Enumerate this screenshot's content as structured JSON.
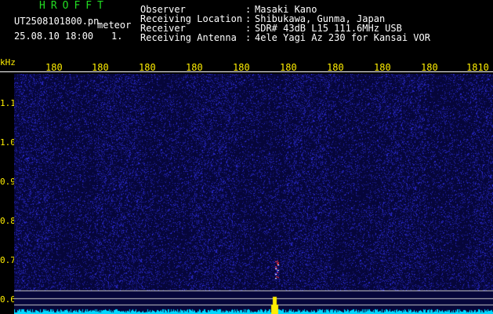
{
  "header": {
    "app_title": "HROFFT",
    "file_name": "UT2508101800.pn",
    "meteor_label": "meteor",
    "datetime": "25.08.10 18:00",
    "index": "1.",
    "info": [
      {
        "label": "Observer",
        "value": "Masaki Kano"
      },
      {
        "label": "Receiving Location",
        "value": "Shibukawa, Gunma, Japan"
      },
      {
        "label": "Receiver",
        "value": "SDR# 43dB L15 111.6MHz USB"
      },
      {
        "label": "Receiving Antenna",
        "value": "4ele Yagi Az 230 for Kansai VOR"
      }
    ]
  },
  "y_axis": {
    "unit": "kHz",
    "ticks": [
      "1.1",
      "1.0",
      "0.9",
      "0.8",
      "0.7",
      "0.6"
    ]
  },
  "x_axis": {
    "ticks": [
      "180",
      "180",
      "180",
      "180",
      "180",
      "180",
      "180",
      "180",
      "180",
      "1810"
    ]
  },
  "colors": {
    "background": "#000000",
    "plot_base": "#06063a",
    "noise": "#2a2ad8",
    "signal": "#ff3030",
    "bottom_trace": "#00d8ff",
    "peak": "#ffee00",
    "axis_text": "#ffee00",
    "title": "#22dd22"
  }
}
